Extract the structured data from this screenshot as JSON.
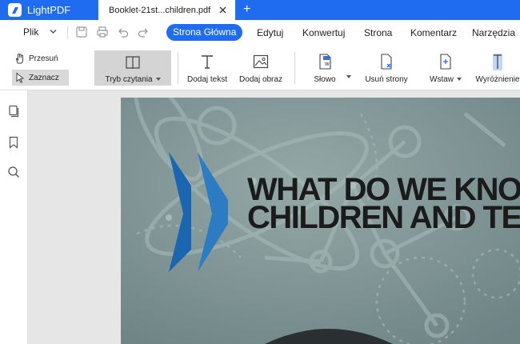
{
  "app": {
    "name": "LightPDF",
    "brand_color": "#1f6cf0"
  },
  "tabs": [
    {
      "label": "Booklet-21st...children.pdf",
      "icon": "close-icon"
    }
  ],
  "new_tab_label": "+",
  "menu": {
    "file_label": "Plik",
    "items": [
      {
        "label": "Strona Główna",
        "active": true
      },
      {
        "label": "Edytuj"
      },
      {
        "label": "Konwertuj"
      },
      {
        "label": "Strona"
      },
      {
        "label": "Komentarz"
      },
      {
        "label": "Narzędzia"
      }
    ]
  },
  "quick_tools": [
    "save-icon",
    "print-icon",
    "undo-icon",
    "redo-icon"
  ],
  "ribbon": {
    "small_tools": [
      {
        "label": "Przesuń",
        "icon": "hand-icon"
      },
      {
        "label": "Zaznacz",
        "icon": "cursor-icon",
        "selected": true
      }
    ],
    "tools": [
      {
        "label": "Tryb czytania",
        "icon": "book-icon",
        "dropdown": true,
        "selected": true
      },
      {
        "label": "Dodaj tekst",
        "icon": "text-icon"
      },
      {
        "label": "Dodaj obraz",
        "icon": "image-icon"
      },
      {
        "label": "Słowo",
        "icon": "word-icon",
        "dropdown": true
      },
      {
        "label": "Usuń strony",
        "icon": "delete-page-icon"
      },
      {
        "label": "Wstaw",
        "icon": "insert-page-icon",
        "dropdown": true
      },
      {
        "label": "Wyróżnienie",
        "icon": "highlight-icon"
      }
    ]
  },
  "sidebar": [
    "pages-icon",
    "bookmark-icon",
    "search-icon"
  ],
  "document": {
    "headline_line1": "WHAT DO WE KNOW",
    "headline_line2": "CHILDREN AND TE",
    "logo_color": "#1b66b0"
  }
}
